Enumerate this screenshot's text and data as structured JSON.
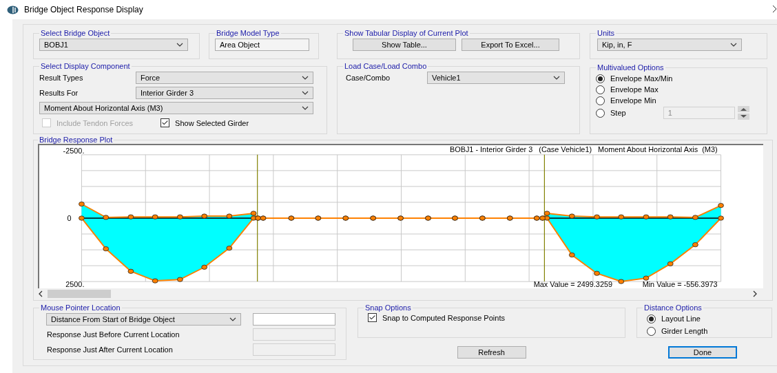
{
  "window": {
    "title": "Bridge Object Response Display"
  },
  "select_bridge_object": {
    "title": "Select Bridge Object",
    "value": "BOBJ1"
  },
  "bridge_model_type": {
    "title": "Bridge Model Type",
    "value": "Area Object"
  },
  "tabular_display": {
    "title": "Show Tabular Display of Current Plot",
    "buttons": [
      "Show Table...",
      "Export To Excel..."
    ]
  },
  "units": {
    "title": "Units",
    "value": "Kip, in, F"
  },
  "display_component": {
    "title": "Select Display Component",
    "result_types": {
      "label": "Result Types",
      "value": "Force"
    },
    "results_for": {
      "label": "Results For",
      "value": "Interior Girder 3"
    },
    "component": {
      "value": "Moment About Horizontal Axis  (M3)"
    },
    "checkboxes": [
      {
        "label": "Include Tendon Forces",
        "checked": false,
        "disabled": true
      },
      {
        "label": "Show Selected Girder",
        "checked": true,
        "disabled": false
      }
    ]
  },
  "load_case": {
    "title": "Load Case/Load Combo",
    "label": "Case/Combo",
    "value": "Vehicle1"
  },
  "multivalued_options": {
    "title": "Multivalued Options",
    "options": [
      {
        "label": "Envelope Max/Min",
        "selected": true
      },
      {
        "label": "Envelope Max",
        "selected": false
      },
      {
        "label": "Envelope Min",
        "selected": false
      },
      {
        "label": "Step",
        "selected": false
      }
    ],
    "step_field": {
      "value": "1",
      "disabled": true
    }
  },
  "plot": {
    "title": "Bridge Response Plot",
    "chart_title": "BOBJ1 - Interior Girder 3   (Case Vehicle1)   Moment About Horizontal Axis  (M3)",
    "axis_labels": [
      "-2500.",
      "0",
      "2500."
    ],
    "max_label": "Max Value = 2499.3259",
    "min_label": "Min Value = -556.3973"
  },
  "mouse_pointer": {
    "title": "Mouse Pointer Location",
    "mode": "Distance From Start of Bridge Object",
    "mode_field": {
      "disabled": false
    },
    "rows": [
      {
        "label": "Response Just Before Current Location",
        "disabled": true
      },
      {
        "label": "Response Just After Current Location",
        "disabled": true
      }
    ]
  },
  "snap_options": {
    "title": "Snap Options",
    "checkboxes": [
      {
        "label": "Snap to Computed Response Points",
        "checked": true
      }
    ]
  },
  "distance_options": {
    "title": "Distance Options",
    "options": [
      {
        "label": "Layout Line",
        "selected": true
      },
      {
        "label": "Girder Length",
        "selected": false
      }
    ]
  },
  "buttons": [
    {
      "label": "Refresh",
      "focused": false
    },
    {
      "label": "Done",
      "focused": true
    }
  ]
}
